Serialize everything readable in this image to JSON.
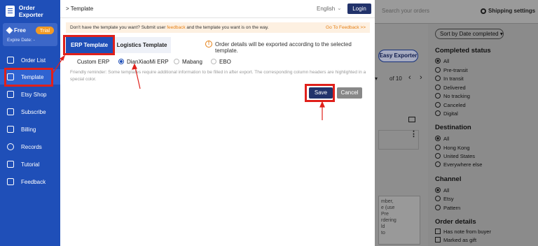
{
  "app": {
    "name": "Order Exporter",
    "plan": "Free",
    "trial": "Trial",
    "expire": "Expire Date: -"
  },
  "sidebar": {
    "items": [
      {
        "label": "Order List"
      },
      {
        "label": "Template"
      },
      {
        "label": "Etsy Shop"
      },
      {
        "label": "Subscribe"
      },
      {
        "label": "Billing"
      },
      {
        "label": "Records"
      },
      {
        "label": "Tutorial"
      },
      {
        "label": "Feedback"
      }
    ]
  },
  "modal": {
    "breadcrumb": "> Template",
    "language": "English",
    "login": "Login",
    "notice": {
      "prefix": "Don't have the template you want? Submit user ",
      "feedback": "feedback",
      "suffix": " and the template you want is on the way.",
      "link": "Go To Feedback >>"
    },
    "tabs": {
      "erp": "ERP Template",
      "logistics": "Logistics Template"
    },
    "info": "Order details will be exported according to the selected template.",
    "erp_options": [
      {
        "label": "Custom ERP",
        "selected": false
      },
      {
        "label": "DianXiaoMi ERP",
        "selected": true
      },
      {
        "label": "Mabang",
        "selected": false
      },
      {
        "label": "EBO",
        "selected": false
      }
    ],
    "reminder": "Friendly reminder: Some templates require additional information to be filled in after export. The corresponding column headers are highlighted in a special color.",
    "save": "Save",
    "cancel": "Cancel"
  },
  "background": {
    "search_placeholder": "Search your orders",
    "shipping_settings": "Shipping settings",
    "easy_exporter": "Easy Exporter",
    "pager": "of 10",
    "notes": [
      "mber,",
      "e (use",
      "Pre",
      "rdering",
      "ld",
      "to"
    ],
    "sort_by": "Sort by  Date completed",
    "filters": {
      "completed_status": {
        "title": "Completed status",
        "options": [
          "All",
          "Pre-transit",
          "In transit",
          "Delivered",
          "No tracking",
          "Canceled",
          "Digital"
        ]
      },
      "destination": {
        "title": "Destination",
        "options": [
          "All",
          "Hong Kong",
          "United States",
          "Everywhere else"
        ]
      },
      "channel": {
        "title": "Channel",
        "options": [
          "All",
          "Etsy",
          "Pattern"
        ]
      },
      "order_details": {
        "title": "Order details",
        "options": [
          "Has note from buyer",
          "Marked as gift"
        ]
      }
    }
  },
  "colors": {
    "sidebar": "#1f4fb8",
    "primary_button": "#22336b",
    "annotation_red": "#e0201b",
    "accent_orange": "#e57f14"
  }
}
